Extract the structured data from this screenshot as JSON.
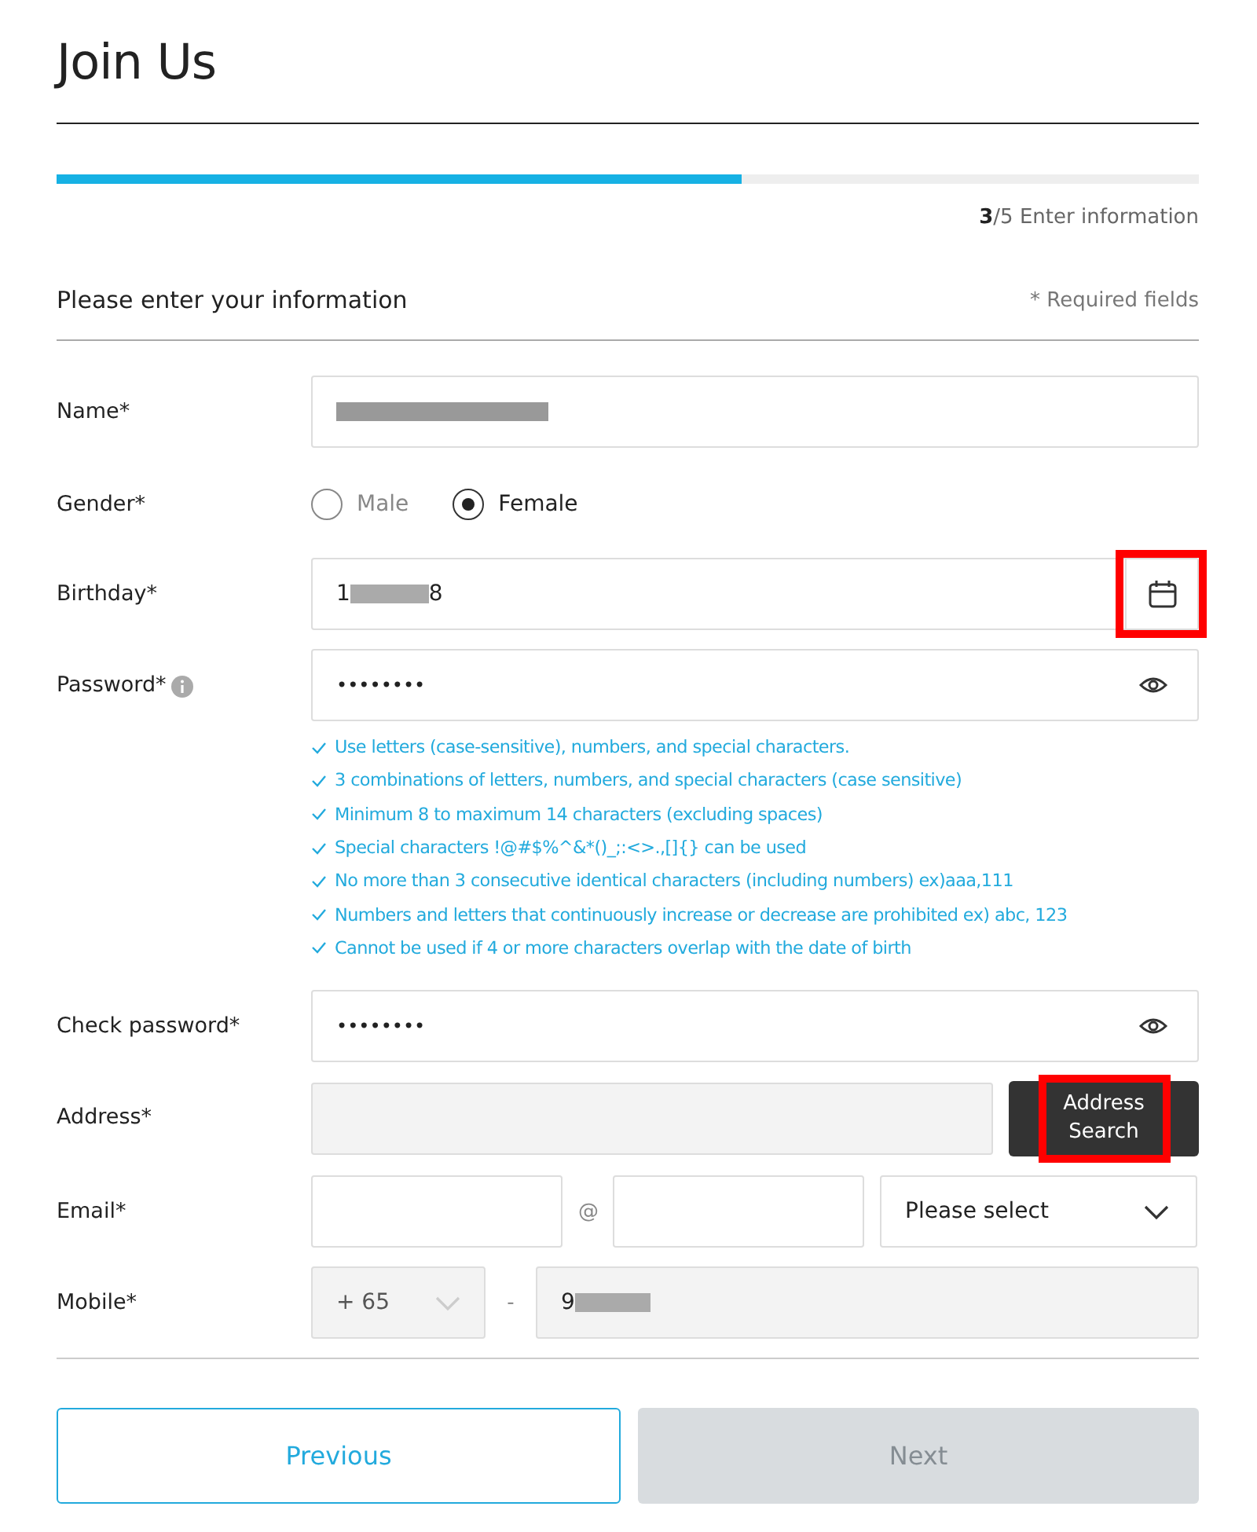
{
  "title": "Join Us",
  "progress": {
    "level": 0.6,
    "step_text": "**3**/5 Enter information"
  },
  "section": {
    "heading": "Please enter your information",
    "note": "* Required fields"
  },
  "fields": [
    {
      "kind": "text",
      "label": "Name*",
      "redacted": true
    },
    {
      "kind": "radio",
      "label": "Gender*",
      "options": [
        {
          "label": "Male",
          "selected": false
        },
        {
          "label": "Female",
          "selected": true
        }
      ]
    },
    {
      "kind": "date",
      "label": "Birthday*",
      "value_start": "1",
      "value_end": "8",
      "redacted": true,
      "highlighted": true
    },
    {
      "kind": "password",
      "label": "Password*",
      "info": true,
      "value": "••••••••",
      "rules": [
        "Use letters (case-sensitive), numbers, and special characters.",
        "3 combinations of letters, numbers, and special characters (case sensitive)",
        "Minimum 8 to maximum 14 characters (excluding spaces)",
        "Special characters !@#$%^&*()_;:<>.,[]{} can be used",
        "No more than 3 consecutive identical characters (including numbers) ex)aaa,111",
        "Numbers and letters that continuously increase or decrease are prohibited ex) abc, 123",
        "Cannot be used if 4 or more characters overlap with the date of birth"
      ]
    },
    {
      "kind": "password",
      "label": "Check password*",
      "info": false,
      "value": "••••••••"
    },
    {
      "kind": "address",
      "label": "Address*",
      "button": "Address Search",
      "highlighted": true
    },
    {
      "kind": "email",
      "label": "Email*",
      "separator": "@",
      "select": "Please select"
    },
    {
      "kind": "mobile",
      "label": "Mobile*",
      "code": "+ 65",
      "separator": "-",
      "value_start": "9",
      "redacted": true
    }
  ],
  "buttons": [
    {
      "label": "Previous",
      "disabled": false
    },
    {
      "label": "Next",
      "disabled": true
    }
  ]
}
